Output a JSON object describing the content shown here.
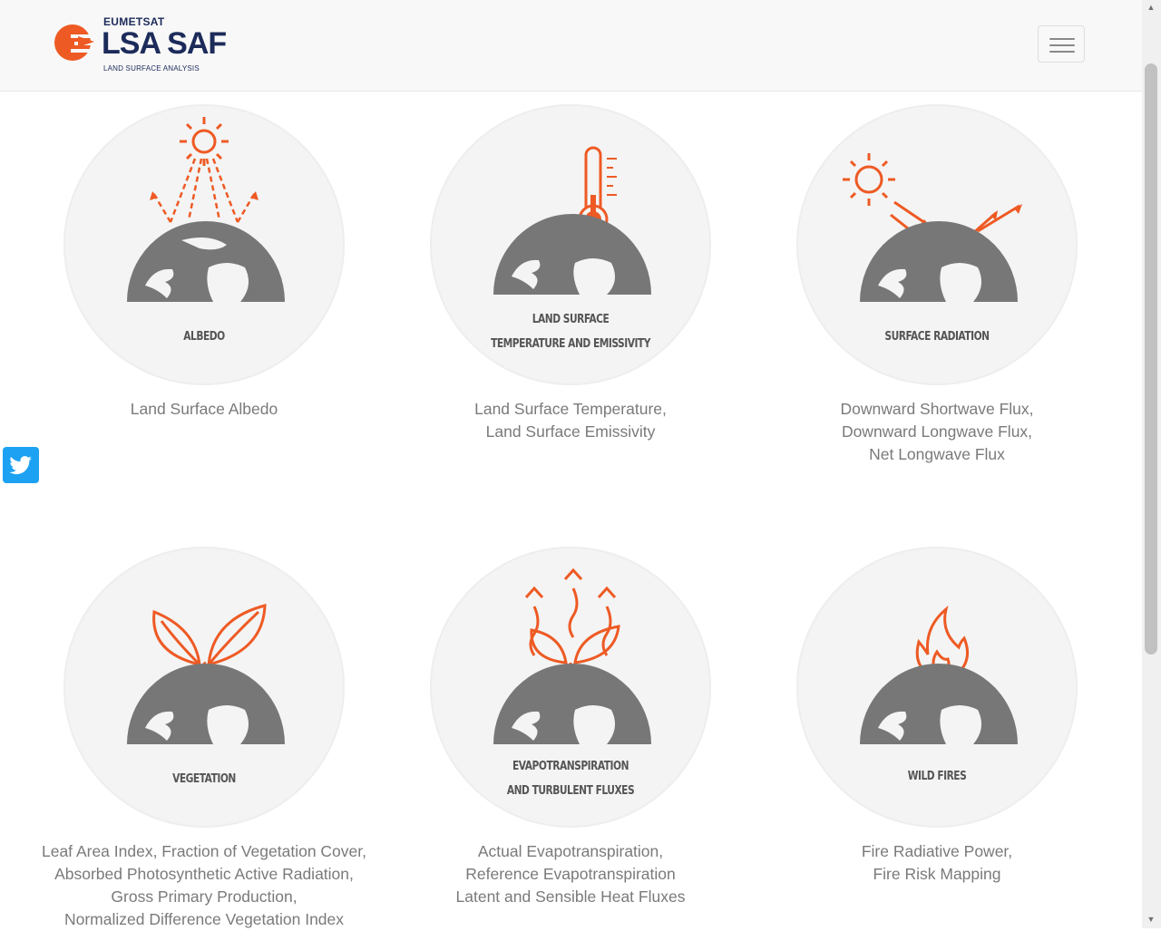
{
  "header": {
    "brand_top": "EUMETSAT",
    "brand_main": "LSA SAF",
    "brand_sub": "LAND SURFACE ANALYSIS"
  },
  "social": {
    "icon": "twitter-icon"
  },
  "colors": {
    "accent": "#ee5a24",
    "globe": "#777777",
    "circle": "#f4f4f4",
    "text": "#7a7a7a"
  },
  "products": [
    {
      "label_lines": [
        "ALBEDO"
      ],
      "description": [
        "Land Surface Albedo"
      ]
    },
    {
      "label_lines": [
        "LAND SURFACE",
        "TEMPERATURE AND EMISSIVITY"
      ],
      "description": [
        "Land Surface Temperature,",
        "Land Surface Emissivity"
      ]
    },
    {
      "label_lines": [
        "SURFACE RADIATION"
      ],
      "description": [
        "Downward Shortwave Flux,",
        "Downward Longwave Flux,",
        "Net Longwave Flux"
      ]
    },
    {
      "label_lines": [
        "VEGETATION"
      ],
      "description": [
        "Leaf Area Index, Fraction of Vegetation Cover,",
        "Absorbed Photosynthetic Active Radiation,",
        "Gross Primary Production,",
        "Normalized Difference Vegetation Index"
      ]
    },
    {
      "label_lines": [
        "EVAPOTRANSPIRATION",
        "AND TURBULENT FLUXES"
      ],
      "description": [
        "Actual Evapotranspiration,",
        "Reference Evapotranspiration",
        "Latent and Sensible Heat Fluxes"
      ]
    },
    {
      "label_lines": [
        "WILD FIRES"
      ],
      "description": [
        "Fire Radiative Power,",
        "Fire Risk Mapping"
      ]
    }
  ]
}
